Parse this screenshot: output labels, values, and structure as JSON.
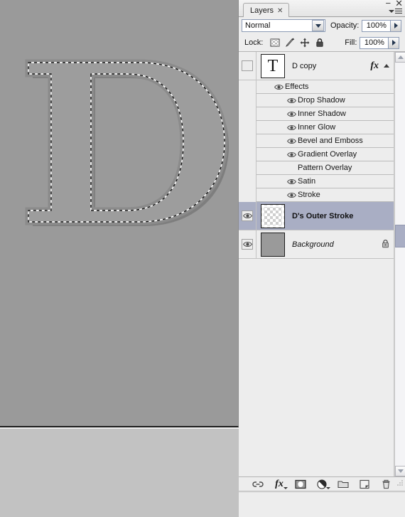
{
  "window": {
    "minimize_label": "−",
    "close_label": "✕"
  },
  "panel": {
    "tab_label": "Layers",
    "tab_close_label": "✕",
    "menu_icon": "panel-menu-icon"
  },
  "blend_row": {
    "blend_mode": "Normal",
    "blend_mode_dropdown_icon": "chevron-down-icon",
    "opacity_label": "Opacity:",
    "opacity_value": "100%",
    "opacity_spinner_icon": "chevron-right-icon"
  },
  "lock_row": {
    "lock_label": "Lock:",
    "lock_icons": [
      {
        "name": "lock-transparency-icon",
        "title": "Lock transparent pixels"
      },
      {
        "name": "lock-image-icon",
        "title": "Lock image pixels"
      },
      {
        "name": "lock-position-icon",
        "title": "Lock position"
      },
      {
        "name": "lock-all-icon",
        "title": "Lock all"
      }
    ],
    "fill_label": "Fill:",
    "fill_value": "100%",
    "fill_spinner_icon": "chevron-right-icon"
  },
  "layers": [
    {
      "name": "D copy",
      "visible": false,
      "selected": false,
      "thumb_type": "text",
      "thumb_glyph": "T",
      "has_fx": true,
      "fx_glyph": "fx",
      "collapse_icon": "triangle-up-icon",
      "locked": false
    },
    {
      "name": "D's Outer Stroke",
      "visible": true,
      "selected": true,
      "thumb_type": "transparent",
      "has_fx": false,
      "locked": false
    },
    {
      "name": "Background",
      "visible": true,
      "selected": false,
      "thumb_type": "solid",
      "thumb_color": "#9a9a9a",
      "has_fx": false,
      "locked": true,
      "lock_icon": "lock-icon"
    }
  ],
  "effects": {
    "group_label": "Effects",
    "group_visible": true,
    "items": [
      {
        "label": "Drop Shadow",
        "visible": true
      },
      {
        "label": "Inner Shadow",
        "visible": true
      },
      {
        "label": "Inner Glow",
        "visible": true
      },
      {
        "label": "Bevel and Emboss",
        "visible": true
      },
      {
        "label": "Gradient Overlay",
        "visible": true
      },
      {
        "label": "Pattern Overlay",
        "visible": false
      },
      {
        "label": "Satin",
        "visible": true
      },
      {
        "label": "Stroke",
        "visible": true
      }
    ]
  },
  "scrollbar": {
    "up_icon": "scroll-up-icon",
    "down_icon": "scroll-down-icon"
  },
  "bottom_toolbar": [
    {
      "name": "link-layers-button",
      "icon": "link-icon",
      "has_menu": false
    },
    {
      "name": "layer-style-button",
      "icon": "fx-icon",
      "label": "fx",
      "has_menu": true
    },
    {
      "name": "add-layer-mask-button",
      "icon": "mask-icon",
      "has_menu": false
    },
    {
      "name": "new-adjustment-layer-button",
      "icon": "half-circle-icon",
      "has_menu": true
    },
    {
      "name": "new-group-button",
      "icon": "folder-icon",
      "has_menu": false
    },
    {
      "name": "new-layer-button",
      "icon": "new-layer-icon",
      "has_menu": false
    },
    {
      "name": "delete-layer-button",
      "icon": "trash-icon",
      "has_menu": false
    }
  ],
  "canvas": {
    "background_color": "#9a9a9a",
    "glyph": "D",
    "selection": "marching-ants",
    "description": "Serif letter D with drop shadow and active selection outline"
  }
}
